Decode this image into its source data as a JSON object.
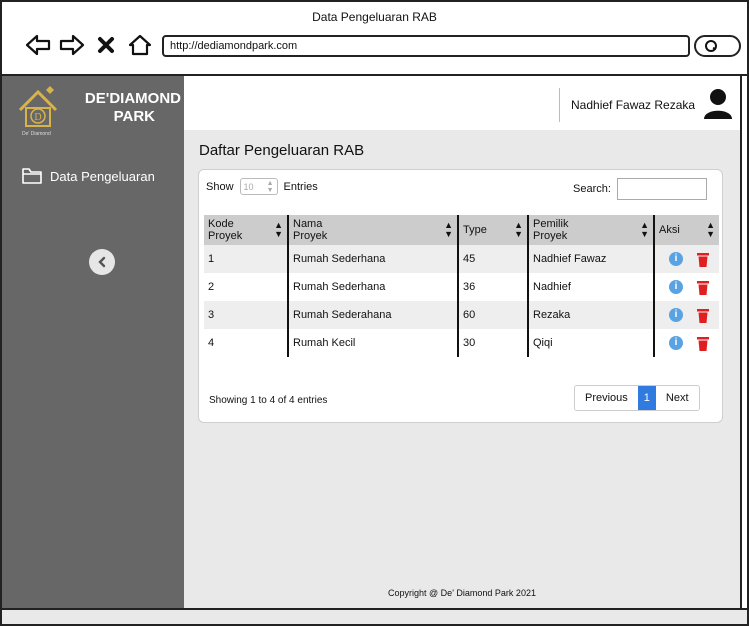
{
  "window": {
    "title": "Data Pengeluaran RAB",
    "url": "http://dediamondpark.com"
  },
  "sidebar": {
    "brand": {
      "line1": "DE'DIAMOND",
      "line2": "PARK",
      "sub": "De' Diamond"
    },
    "items": [
      {
        "label": "Data Pengeluaran",
        "icon": "folder-icon"
      }
    ]
  },
  "topbar": {
    "user_name": "Nadhief Fawaz Rezaka"
  },
  "page": {
    "title": "Daftar Pengeluaran RAB"
  },
  "table_controls": {
    "show_label": "Show",
    "page_length": "10",
    "entries_label": "Entries",
    "search_label": "Search:"
  },
  "table": {
    "headers": [
      {
        "line1": "Kode",
        "line2": "Proyek"
      },
      {
        "line1": "Nama",
        "line2": "Proyek"
      },
      {
        "line1": "Type",
        "line2": ""
      },
      {
        "line1": "Pemilik",
        "line2": "Proyek"
      },
      {
        "line1": "Aksi",
        "line2": ""
      }
    ],
    "rows": [
      {
        "kode": "1",
        "nama": "Rumah Sederhana",
        "type": "45",
        "pemilik": "Nadhief Fawaz"
      },
      {
        "kode": "2",
        "nama": "Rumah Sederhana",
        "type": "36",
        "pemilik": "Nadhief"
      },
      {
        "kode": "3",
        "nama": "Rumah Sederahana",
        "type": "60",
        "pemilik": "Rezaka"
      },
      {
        "kode": "4",
        "nama": "Rumah Kecil",
        "type": "30",
        "pemilik": "Qiqi"
      }
    ]
  },
  "pagination": {
    "info": "Showing 1 to 4 of 4 entries",
    "previous": "Previous",
    "current": "1",
    "next": "Next"
  },
  "footer": {
    "text": "Copyright @ De' Diamond Park 2021"
  },
  "colors": {
    "sidebar": "#676767",
    "accent": "#2f7be0",
    "danger": "#e02020",
    "info": "#5aa3e3"
  }
}
